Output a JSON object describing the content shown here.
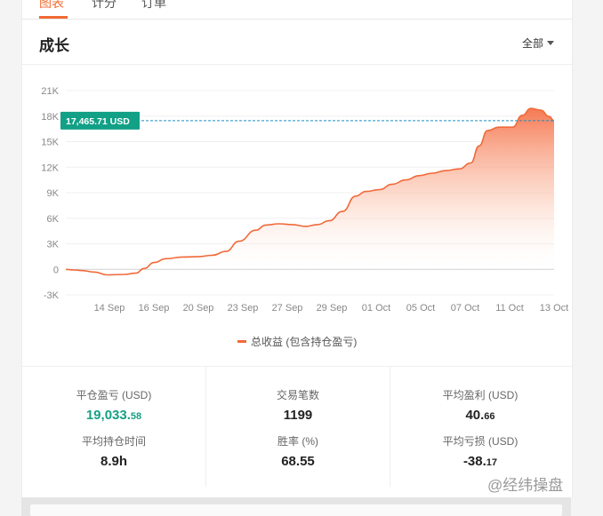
{
  "tabs": [
    {
      "label": "图表",
      "active": true
    },
    {
      "label": "计分"
    },
    {
      "label": "订单"
    }
  ],
  "section": {
    "title": "成长",
    "range_label": "全部"
  },
  "chart_data": {
    "type": "area",
    "series": [
      {
        "name": "总收益 (包含持仓盈亏)",
        "color": "#f06a3a"
      }
    ],
    "y_ticks": [
      "21K",
      "18K",
      "15K",
      "12K",
      "9K",
      "6K",
      "3K",
      "0",
      "-3K"
    ],
    "ylim": [
      -3000,
      21000
    ],
    "x_ticks": [
      "14 Sep",
      "16 Sep",
      "20 Sep",
      "23 Sep",
      "27 Sep",
      "29 Sep",
      "01 Oct",
      "05 Oct",
      "07 Oct",
      "11 Oct",
      "13 Oct"
    ],
    "current_value_label": "17,465.71 USD",
    "current_value": 17465.71,
    "points": [
      [
        0,
        0
      ],
      [
        0.5,
        -80
      ],
      [
        1,
        -150
      ],
      [
        1.7,
        -320
      ],
      [
        2.5,
        -650
      ],
      [
        3.5,
        -600
      ],
      [
        4.2,
        -450
      ],
      [
        4.7,
        100
      ],
      [
        5.3,
        800
      ],
      [
        6,
        1250
      ],
      [
        7,
        1450
      ],
      [
        8,
        1500
      ],
      [
        8.8,
        1650
      ],
      [
        9.6,
        2100
      ],
      [
        10.4,
        3300
      ],
      [
        11.4,
        4600
      ],
      [
        12,
        5200
      ],
      [
        12.8,
        5350
      ],
      [
        13.6,
        5250
      ],
      [
        14.4,
        5050
      ],
      [
        15.1,
        5250
      ],
      [
        15.8,
        5700
      ],
      [
        16.6,
        6800
      ],
      [
        17.4,
        8600
      ],
      [
        18,
        9150
      ],
      [
        18.8,
        9350
      ],
      [
        19.6,
        10000
      ],
      [
        20.4,
        10500
      ],
      [
        21.2,
        11000
      ],
      [
        22,
        11300
      ],
      [
        22.8,
        11600
      ],
      [
        23.6,
        11800
      ],
      [
        24.3,
        12500
      ],
      [
        24.8,
        14500
      ],
      [
        25.3,
        16300
      ],
      [
        26,
        16700
      ],
      [
        26.8,
        16700
      ],
      [
        27.4,
        18100
      ],
      [
        27.9,
        18900
      ],
      [
        28.5,
        18700
      ],
      [
        29,
        17950
      ],
      [
        29.3,
        17465.71
      ]
    ],
    "legend_position": "bottom"
  },
  "stats": [
    {
      "label": "平仓盈亏 (USD)",
      "value": "19,033.",
      "decimal": "58",
      "color": "#16a085"
    },
    {
      "label": "交易笔数",
      "value": "1199",
      "decimal": ""
    },
    {
      "label": "平均盈利 (USD)",
      "value": "40.",
      "decimal": "66"
    },
    {
      "label": "平均持仓时间",
      "value": "8.9h",
      "decimal": ""
    },
    {
      "label": "胜率 (%)",
      "value": "68.55",
      "decimal": ""
    },
    {
      "label": "平均亏损 (USD)",
      "value": "-38.",
      "decimal": "17"
    }
  ],
  "watermark": "@经纬操盘"
}
